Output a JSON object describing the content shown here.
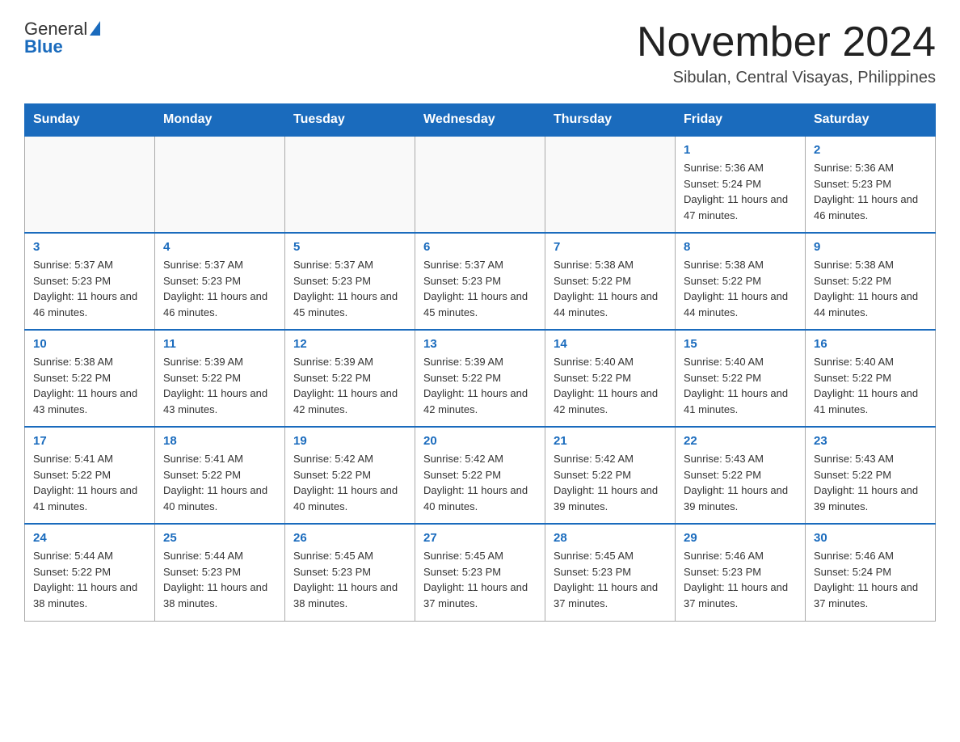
{
  "header": {
    "logo_text_general": "General",
    "logo_text_blue": "Blue",
    "main_title": "November 2024",
    "subtitle": "Sibulan, Central Visayas, Philippines"
  },
  "calendar": {
    "days_of_week": [
      "Sunday",
      "Monday",
      "Tuesday",
      "Wednesday",
      "Thursday",
      "Friday",
      "Saturday"
    ],
    "weeks": [
      [
        {
          "day": "",
          "info": ""
        },
        {
          "day": "",
          "info": ""
        },
        {
          "day": "",
          "info": ""
        },
        {
          "day": "",
          "info": ""
        },
        {
          "day": "",
          "info": ""
        },
        {
          "day": "1",
          "info": "Sunrise: 5:36 AM\nSunset: 5:24 PM\nDaylight: 11 hours and 47 minutes."
        },
        {
          "day": "2",
          "info": "Sunrise: 5:36 AM\nSunset: 5:23 PM\nDaylight: 11 hours and 46 minutes."
        }
      ],
      [
        {
          "day": "3",
          "info": "Sunrise: 5:37 AM\nSunset: 5:23 PM\nDaylight: 11 hours and 46 minutes."
        },
        {
          "day": "4",
          "info": "Sunrise: 5:37 AM\nSunset: 5:23 PM\nDaylight: 11 hours and 46 minutes."
        },
        {
          "day": "5",
          "info": "Sunrise: 5:37 AM\nSunset: 5:23 PM\nDaylight: 11 hours and 45 minutes."
        },
        {
          "day": "6",
          "info": "Sunrise: 5:37 AM\nSunset: 5:23 PM\nDaylight: 11 hours and 45 minutes."
        },
        {
          "day": "7",
          "info": "Sunrise: 5:38 AM\nSunset: 5:22 PM\nDaylight: 11 hours and 44 minutes."
        },
        {
          "day": "8",
          "info": "Sunrise: 5:38 AM\nSunset: 5:22 PM\nDaylight: 11 hours and 44 minutes."
        },
        {
          "day": "9",
          "info": "Sunrise: 5:38 AM\nSunset: 5:22 PM\nDaylight: 11 hours and 44 minutes."
        }
      ],
      [
        {
          "day": "10",
          "info": "Sunrise: 5:38 AM\nSunset: 5:22 PM\nDaylight: 11 hours and 43 minutes."
        },
        {
          "day": "11",
          "info": "Sunrise: 5:39 AM\nSunset: 5:22 PM\nDaylight: 11 hours and 43 minutes."
        },
        {
          "day": "12",
          "info": "Sunrise: 5:39 AM\nSunset: 5:22 PM\nDaylight: 11 hours and 42 minutes."
        },
        {
          "day": "13",
          "info": "Sunrise: 5:39 AM\nSunset: 5:22 PM\nDaylight: 11 hours and 42 minutes."
        },
        {
          "day": "14",
          "info": "Sunrise: 5:40 AM\nSunset: 5:22 PM\nDaylight: 11 hours and 42 minutes."
        },
        {
          "day": "15",
          "info": "Sunrise: 5:40 AM\nSunset: 5:22 PM\nDaylight: 11 hours and 41 minutes."
        },
        {
          "day": "16",
          "info": "Sunrise: 5:40 AM\nSunset: 5:22 PM\nDaylight: 11 hours and 41 minutes."
        }
      ],
      [
        {
          "day": "17",
          "info": "Sunrise: 5:41 AM\nSunset: 5:22 PM\nDaylight: 11 hours and 41 minutes."
        },
        {
          "day": "18",
          "info": "Sunrise: 5:41 AM\nSunset: 5:22 PM\nDaylight: 11 hours and 40 minutes."
        },
        {
          "day": "19",
          "info": "Sunrise: 5:42 AM\nSunset: 5:22 PM\nDaylight: 11 hours and 40 minutes."
        },
        {
          "day": "20",
          "info": "Sunrise: 5:42 AM\nSunset: 5:22 PM\nDaylight: 11 hours and 40 minutes."
        },
        {
          "day": "21",
          "info": "Sunrise: 5:42 AM\nSunset: 5:22 PM\nDaylight: 11 hours and 39 minutes."
        },
        {
          "day": "22",
          "info": "Sunrise: 5:43 AM\nSunset: 5:22 PM\nDaylight: 11 hours and 39 minutes."
        },
        {
          "day": "23",
          "info": "Sunrise: 5:43 AM\nSunset: 5:22 PM\nDaylight: 11 hours and 39 minutes."
        }
      ],
      [
        {
          "day": "24",
          "info": "Sunrise: 5:44 AM\nSunset: 5:22 PM\nDaylight: 11 hours and 38 minutes."
        },
        {
          "day": "25",
          "info": "Sunrise: 5:44 AM\nSunset: 5:23 PM\nDaylight: 11 hours and 38 minutes."
        },
        {
          "day": "26",
          "info": "Sunrise: 5:45 AM\nSunset: 5:23 PM\nDaylight: 11 hours and 38 minutes."
        },
        {
          "day": "27",
          "info": "Sunrise: 5:45 AM\nSunset: 5:23 PM\nDaylight: 11 hours and 37 minutes."
        },
        {
          "day": "28",
          "info": "Sunrise: 5:45 AM\nSunset: 5:23 PM\nDaylight: 11 hours and 37 minutes."
        },
        {
          "day": "29",
          "info": "Sunrise: 5:46 AM\nSunset: 5:23 PM\nDaylight: 11 hours and 37 minutes."
        },
        {
          "day": "30",
          "info": "Sunrise: 5:46 AM\nSunset: 5:24 PM\nDaylight: 11 hours and 37 minutes."
        }
      ]
    ]
  }
}
